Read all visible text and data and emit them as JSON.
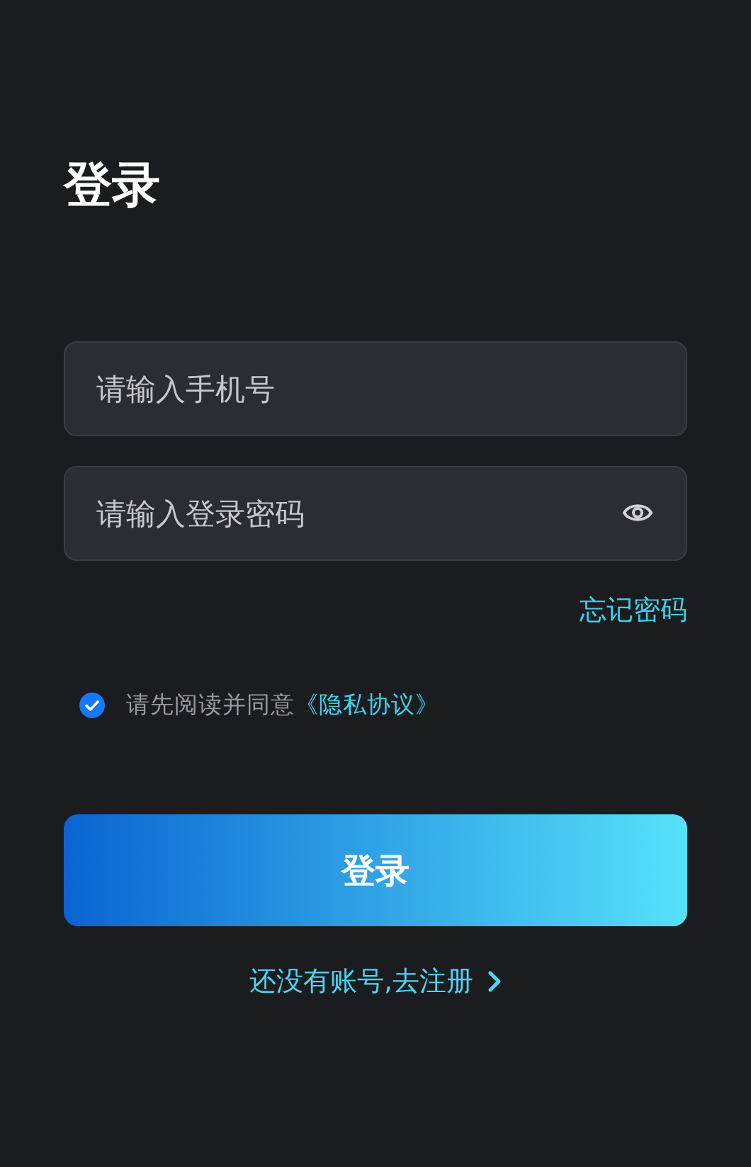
{
  "title": "登录",
  "phone_field": {
    "placeholder": "请输入手机号"
  },
  "password_field": {
    "placeholder": "请输入登录密码",
    "password_visible": false
  },
  "forgot_link": "忘记密码",
  "agreement": {
    "checked": true,
    "text": "请先阅读并同意",
    "link": "《隐私协议》"
  },
  "login_button": "登录",
  "register_link": "还没有账号,去注册"
}
